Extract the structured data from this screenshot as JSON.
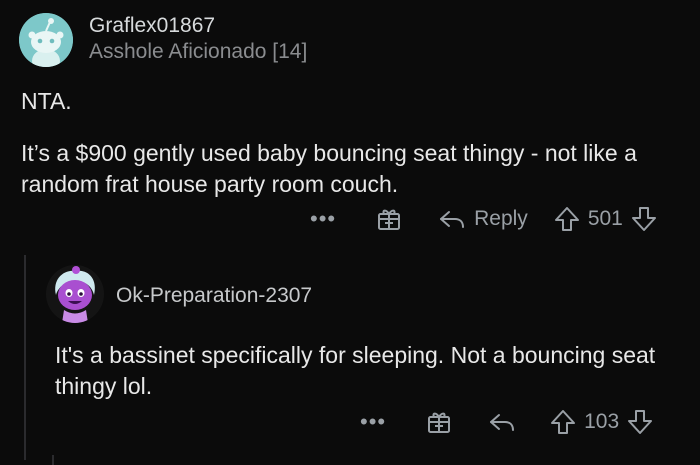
{
  "comment1": {
    "username": "Graflex01867",
    "flair": "Asshole Aficionado [14]",
    "paragraphs": [
      "NTA.",
      "It’s a $900 gently used baby bouncing seat thingy - not like a random frat house party room couch."
    ],
    "actions": {
      "more": "•••",
      "reply_label": "Reply",
      "score": "501"
    }
  },
  "comment2": {
    "username": "Ok-Preparation-2307",
    "paragraphs": [
      "It's a bassinet specifically for sleeping. Not a bouncing seat thingy lol."
    ],
    "actions": {
      "more": "•••",
      "score": "103"
    }
  },
  "icons": {
    "more": "more-icon",
    "gift": "gift-award-icon",
    "reply": "reply-arrow-icon",
    "upvote": "upvote-arrow-icon",
    "downvote": "downvote-arrow-icon"
  },
  "colors": {
    "background": "#0b0b0b",
    "text": "#e8e8e8",
    "muted": "#8a8c8f",
    "avatar1": "#7dc8c9",
    "avatar2_accent": "#b14fd6"
  }
}
